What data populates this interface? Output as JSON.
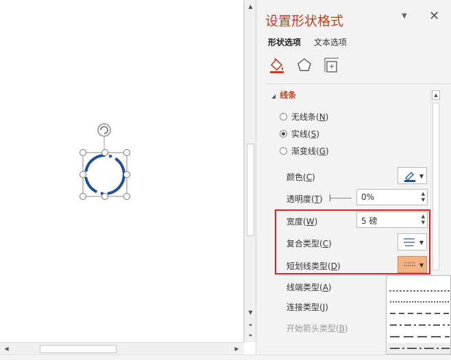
{
  "panel": {
    "title": "设置形状格式",
    "close": "✕",
    "dropdown": "▼",
    "tabs": [
      {
        "label": "形状选项",
        "active": true
      },
      {
        "label": "文本选项",
        "active": false
      }
    ],
    "categories": [
      "fill-line-icon",
      "effects-pentagon-icon",
      "size-properties-icon"
    ]
  },
  "line_section": {
    "title": "线条",
    "radios": [
      {
        "label": "无线条(N)",
        "text": "无线条(",
        "key": "N",
        "end": ")",
        "selected": false
      },
      {
        "label": "实线(S)",
        "text": "实线(",
        "key": "S",
        "end": ")",
        "selected": true
      },
      {
        "label": "渐变线(G)",
        "text": "渐变线(",
        "key": "G",
        "end": ")",
        "selected": false
      }
    ],
    "color": {
      "text": "颜色(",
      "key": "C",
      "end": ")"
    },
    "transparency": {
      "text": "透明度(",
      "key": "T",
      "end": ")",
      "value": "0%"
    },
    "width": {
      "text": "宽度(",
      "key": "W",
      "end": ")",
      "value": "5 磅"
    },
    "compound": {
      "text": "复合类型(",
      "key": "C",
      "end": ")"
    },
    "dash": {
      "text": "短划线类型(",
      "key": "D",
      "end": ")"
    },
    "cap": {
      "text": "线端类型(",
      "key": "A",
      "end": ")"
    },
    "join": {
      "text": "连接类型(",
      "key": "J",
      "end": ")"
    },
    "arrow_start": {
      "text": "开始箭头类型(",
      "key": "B",
      "end": ")"
    }
  },
  "dash_styles": [
    "round-dot",
    "square-dot",
    "dash",
    "dash-dot",
    "long-dash",
    "long-dash-dot"
  ],
  "colors": {
    "accent": "#c43e1c",
    "highlight": "#f4b183",
    "shape_line": "#1f4e9a",
    "red_box": "#e02020"
  }
}
